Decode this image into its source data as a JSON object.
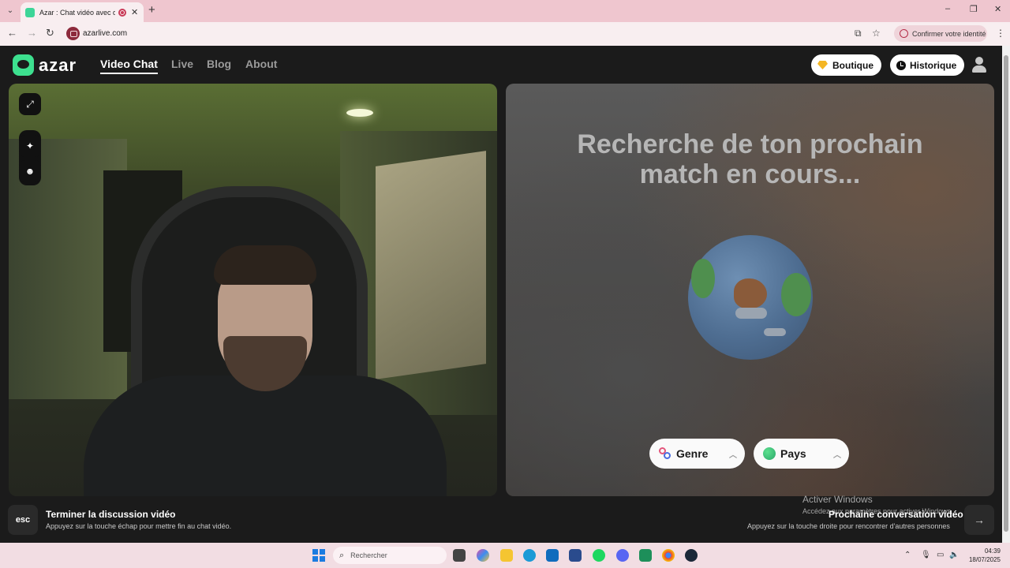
{
  "browser": {
    "tab_title": "Azar : Chat vidéo avec de n",
    "url": "azarlive.com",
    "confirm_identity": "Confirmer votre identité",
    "colors": {
      "tabstrip": "#efc6cf",
      "toolbar": "#f8eef0"
    }
  },
  "header": {
    "logo_text": "azar",
    "nav": [
      {
        "label": "Video Chat",
        "active": true
      },
      {
        "label": "Live",
        "active": false
      },
      {
        "label": "Blog",
        "active": false
      },
      {
        "label": "About",
        "active": false
      }
    ],
    "shop_label": "Boutique",
    "history_label": "Historique"
  },
  "match_panel": {
    "title_line1": "Recherche de ton prochain",
    "title_line2": "match en cours...",
    "gender_filter": "Genre",
    "country_filter": "Pays"
  },
  "footer": {
    "esc_key": "esc",
    "end_title": "Terminer la discussion vidéo",
    "end_sub": "Appuyez sur la touche échap pour mettre fin au chat vidéo.",
    "next_title": "Prochaine conversation vidéo",
    "next_sub": "Appuyez sur la touche droite pour rencontrer d'autres personnes",
    "activate_title": "Activer Windows",
    "activate_sub": "Accédez aux paramètres pour activer Windows."
  },
  "taskbar": {
    "search_placeholder": "Rechercher",
    "time": "04:39",
    "date": "18/07/2025"
  },
  "icons": [
    "menu-icon",
    "record-icon",
    "close-icon",
    "new-tab-icon",
    "back-icon",
    "forward-icon",
    "reload-icon",
    "install-icon",
    "star-icon",
    "gem-icon",
    "clock-icon",
    "user-icon",
    "expand-icon",
    "sparkle-icon",
    "face-icon",
    "globe-icon",
    "arrow-right-icon",
    "windows-icon",
    "search-icon"
  ],
  "accent_color": "#3de08f"
}
